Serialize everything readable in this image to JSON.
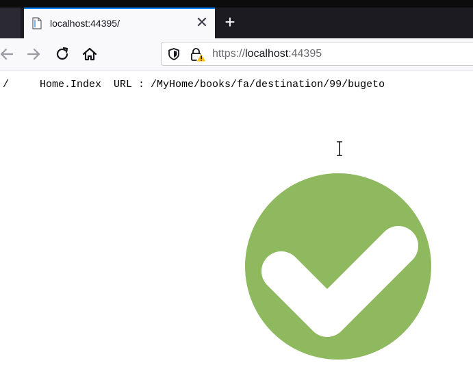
{
  "browser": {
    "tab": {
      "title": "localhost:44395/",
      "favicon": "page-icon",
      "close_glyph": "✕"
    },
    "new_tab_glyph": "+",
    "nav": {
      "back": "back-arrow-icon",
      "forward": "forward-arrow-icon",
      "reload": "reload-icon",
      "home": "home-icon"
    },
    "urlbar": {
      "scheme": "https://",
      "host": "localhost",
      "port": ":44395",
      "shield": "tracking-shield-icon",
      "lock": "insecure-lock-warning-icon"
    }
  },
  "page": {
    "route_text": "/     Home.Index  URL : /MyHome/books/fa/destination/99/bugeto",
    "image": "green-checkmark-circle",
    "colors": {
      "check_green": "#8fb95f",
      "tab_accent": "#0a84ff",
      "warning": "#ffbf00"
    }
  }
}
